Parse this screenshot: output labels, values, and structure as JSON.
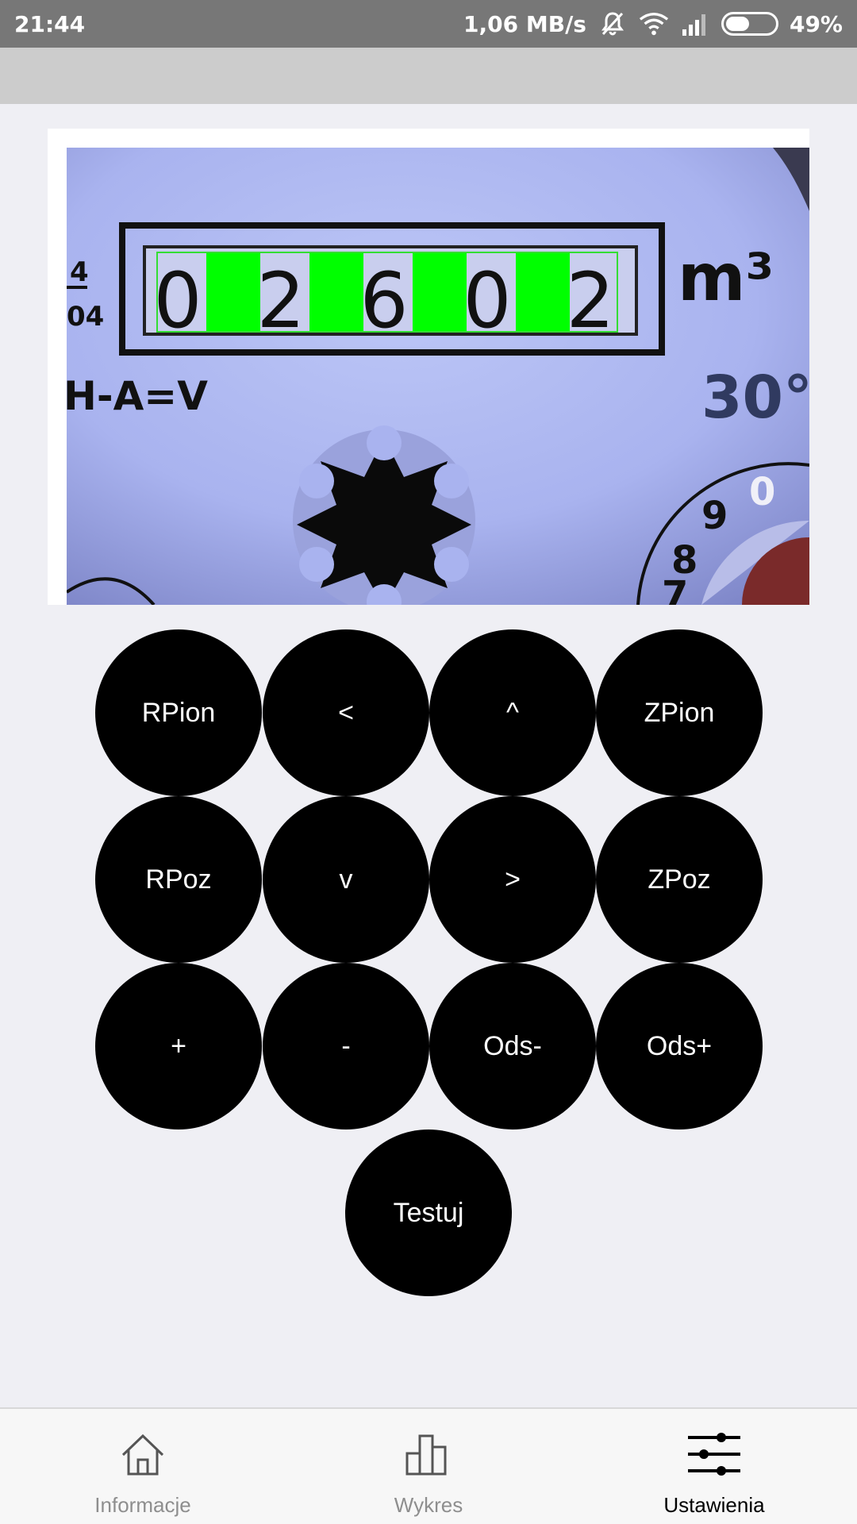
{
  "status_bar": {
    "time": "21:44",
    "network_speed": "1,06 MB/s",
    "battery_percent": "49%",
    "battery_level": 0.49,
    "icons": [
      "bell-off-icon",
      "wifi-icon",
      "signal-icon",
      "battery-icon"
    ]
  },
  "camera_preview": {
    "digits": [
      "0",
      "2",
      "6",
      "0",
      "2"
    ],
    "unit_label": "m³",
    "left_text": "H-A=V",
    "side_small_top": "4",
    "side_small_bottom": "04",
    "right_number": "30°",
    "dial_digits": [
      "9",
      "0",
      "8",
      "7"
    ],
    "highlight_color": "#00ff00"
  },
  "controls": {
    "rpion": "RPion",
    "left": "<",
    "up": "^",
    "zpion": "ZPion",
    "rpoz": "RPoz",
    "down": "v",
    "right": ">",
    "zpoz": "ZPoz",
    "plus": "+",
    "minus": "-",
    "ods_minus": "Ods-",
    "ods_plus": "Ods+",
    "test": "Testuj"
  },
  "bottom_nav": {
    "items": [
      {
        "label": "Informacje",
        "icon": "home-icon",
        "active": false
      },
      {
        "label": "Wykres",
        "icon": "bar-chart-icon",
        "active": false
      },
      {
        "label": "Ustawienia",
        "icon": "sliders-icon",
        "active": true
      }
    ]
  },
  "colors": {
    "status_bar": "#777777",
    "header": "#cccccc",
    "background": "#efeff4",
    "button": "#000000",
    "nav_active": "#000000",
    "nav_inactive": "#8e8e8e"
  }
}
